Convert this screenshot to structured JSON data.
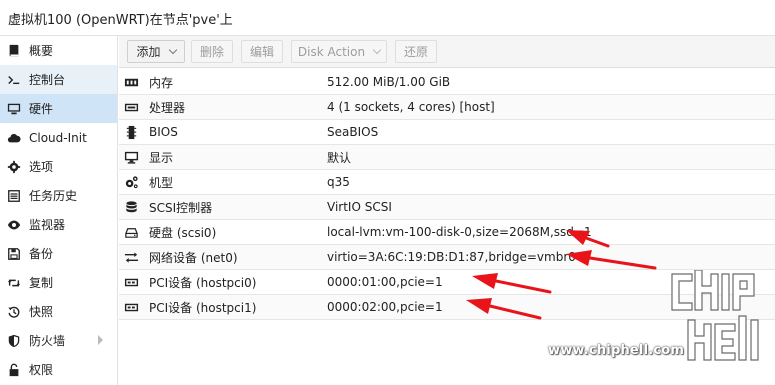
{
  "title": "虚拟机100 (OpenWRT)在节点'pve'上",
  "sidebar": {
    "items": [
      {
        "label": "概要",
        "icon": "book-icon"
      },
      {
        "label": "控制台",
        "icon": "terminal-icon"
      },
      {
        "label": "硬件",
        "icon": "monitor-icon"
      },
      {
        "label": "Cloud-Init",
        "icon": "cloud-icon"
      },
      {
        "label": "选项",
        "icon": "gear-icon"
      },
      {
        "label": "任务历史",
        "icon": "list-icon"
      },
      {
        "label": "监视器",
        "icon": "eye-icon"
      },
      {
        "label": "备份",
        "icon": "floppy-icon"
      },
      {
        "label": "复制",
        "icon": "retweet-icon"
      },
      {
        "label": "快照",
        "icon": "history-icon"
      },
      {
        "label": "防火墙",
        "icon": "shield-icon"
      },
      {
        "label": "权限",
        "icon": "unlock-icon"
      }
    ],
    "active_index": 2
  },
  "toolbar": {
    "add": "添加",
    "remove": "删除",
    "edit": "编辑",
    "disk_action": "Disk Action",
    "revert": "还原"
  },
  "hardware": [
    {
      "name": "内存",
      "value": "512.00 MiB/1.00 GiB",
      "icon": "memory-icon"
    },
    {
      "name": "处理器",
      "value": "4 (1 sockets, 4 cores) [host]",
      "icon": "cpu-icon"
    },
    {
      "name": "BIOS",
      "value": "SeaBIOS",
      "icon": "chip-icon"
    },
    {
      "name": "显示",
      "value": "默认",
      "icon": "desktop-icon"
    },
    {
      "name": "机型",
      "value": "q35",
      "icon": "cogs-icon"
    },
    {
      "name": "SCSI控制器",
      "value": "VirtIO SCSI",
      "icon": "database-icon"
    },
    {
      "name": "硬盘 (scsi0)",
      "value": "local-lvm:vm-100-disk-0,size=2068M,ssd=1",
      "icon": "hdd-icon"
    },
    {
      "name": "网络设备 (net0)",
      "value": "virtio=3A:6C:19:DB:D1:87,bridge=vmbr0",
      "icon": "exchange-icon"
    },
    {
      "name": "PCI设备 (hostpci0)",
      "value": "0000:01:00,pcie=1",
      "icon": "pci-card-icon"
    },
    {
      "name": "PCI设备 (hostpci1)",
      "value": "0000:02:00,pcie=1",
      "icon": "pci-card-icon"
    }
  ],
  "annotation_color": "#e8141a",
  "watermark": {
    "logo": "chip hell",
    "text": "www.chiphell.com"
  }
}
